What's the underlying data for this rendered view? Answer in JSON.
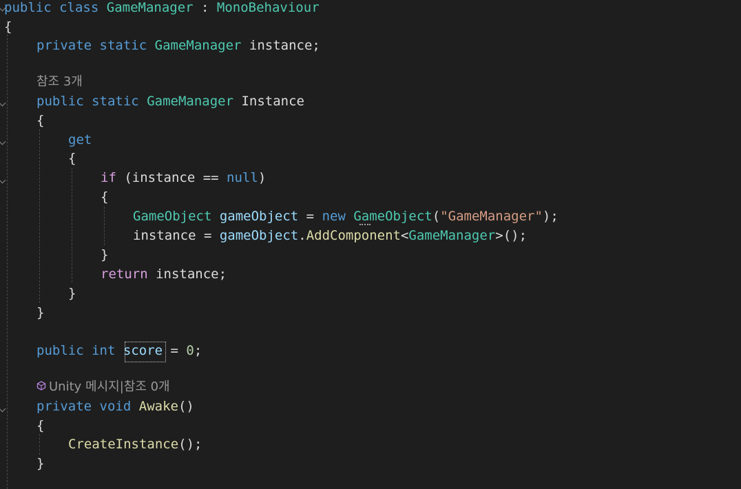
{
  "editor": {
    "lines": [
      {
        "kind": "code",
        "tokens": [
          [
            "kw",
            "public"
          ],
          [
            "plain",
            " "
          ],
          [
            "kw",
            "class"
          ],
          [
            "plain",
            " "
          ],
          [
            "type",
            "GameManager"
          ],
          [
            "plain",
            " : "
          ],
          [
            "type",
            "MonoBehaviour"
          ]
        ]
      },
      {
        "kind": "code",
        "tokens": [
          [
            "plain",
            "{"
          ]
        ]
      },
      {
        "kind": "code",
        "tokens": [
          [
            "kw",
            "private"
          ],
          [
            "plain",
            " "
          ],
          [
            "kw",
            "static"
          ],
          [
            "plain",
            " "
          ],
          [
            "type",
            "GameManager"
          ],
          [
            "plain",
            " instance;"
          ]
        ]
      },
      {
        "kind": "blank"
      },
      {
        "kind": "codelens",
        "text": "참조 3개"
      },
      {
        "kind": "code",
        "tokens": [
          [
            "kw",
            "public"
          ],
          [
            "plain",
            " "
          ],
          [
            "kw",
            "static"
          ],
          [
            "plain",
            " "
          ],
          [
            "type",
            "GameManager"
          ],
          [
            "plain",
            " Instance"
          ]
        ]
      },
      {
        "kind": "code",
        "tokens": [
          [
            "plain",
            "{"
          ]
        ]
      },
      {
        "kind": "code",
        "tokens": [
          [
            "kw",
            "get"
          ]
        ]
      },
      {
        "kind": "code",
        "tokens": [
          [
            "plain",
            "{"
          ]
        ]
      },
      {
        "kind": "code",
        "tokens": [
          [
            "kw2",
            "if"
          ],
          [
            "plain",
            " (instance == "
          ],
          [
            "kw",
            "null"
          ],
          [
            "plain",
            ")"
          ]
        ]
      },
      {
        "kind": "code",
        "tokens": [
          [
            "plain",
            "{"
          ]
        ]
      },
      {
        "kind": "code",
        "tokens": [
          [
            "type",
            "GameObject"
          ],
          [
            "plain",
            " "
          ],
          [
            "var",
            "gameObject"
          ],
          [
            "plain",
            " = "
          ],
          [
            "kw",
            "new"
          ],
          [
            "plain",
            " "
          ],
          [
            "type",
            "GameObject"
          ],
          [
            "plain",
            "("
          ],
          [
            "str",
            "\"GameManager\""
          ],
          [
            "plain",
            ");"
          ]
        ]
      },
      {
        "kind": "code",
        "tokens": [
          [
            "plain",
            "instance = "
          ],
          [
            "var",
            "gameObject"
          ],
          [
            "plain",
            "."
          ],
          [
            "fn",
            "AddComponent"
          ],
          [
            "plain",
            "<"
          ],
          [
            "type",
            "GameManager"
          ],
          [
            "plain",
            ">();"
          ]
        ]
      },
      {
        "kind": "code",
        "tokens": [
          [
            "plain",
            "}"
          ]
        ]
      },
      {
        "kind": "code",
        "tokens": [
          [
            "kw2",
            "return"
          ],
          [
            "plain",
            " instance;"
          ]
        ]
      },
      {
        "kind": "code",
        "tokens": [
          [
            "plain",
            "}"
          ]
        ]
      },
      {
        "kind": "code",
        "tokens": [
          [
            "plain",
            "}"
          ]
        ]
      },
      {
        "kind": "blank"
      },
      {
        "kind": "code",
        "tokens": [
          [
            "kw",
            "public"
          ],
          [
            "plain",
            " "
          ],
          [
            "kw",
            "int"
          ],
          [
            "plain",
            " "
          ],
          [
            "var",
            "score"
          ],
          [
            "plain",
            " = "
          ],
          [
            "num",
            "0"
          ],
          [
            "plain",
            ";"
          ]
        ]
      },
      {
        "kind": "blank"
      },
      {
        "kind": "codelens",
        "icon": "unity-cube-icon",
        "text": "Unity 메시지|참조 0개"
      },
      {
        "kind": "code",
        "tokens": [
          [
            "kw",
            "private"
          ],
          [
            "plain",
            " "
          ],
          [
            "kw",
            "void"
          ],
          [
            "plain",
            " "
          ],
          [
            "fn",
            "Awake"
          ],
          [
            "plain",
            "()"
          ]
        ]
      },
      {
        "kind": "code",
        "tokens": [
          [
            "plain",
            "{"
          ]
        ]
      },
      {
        "kind": "code",
        "tokens": [
          [
            "fn",
            "CreateInstance"
          ],
          [
            "plain",
            "();"
          ]
        ]
      },
      {
        "kind": "code",
        "tokens": [
          [
            "plain",
            "}"
          ]
        ]
      }
    ]
  }
}
